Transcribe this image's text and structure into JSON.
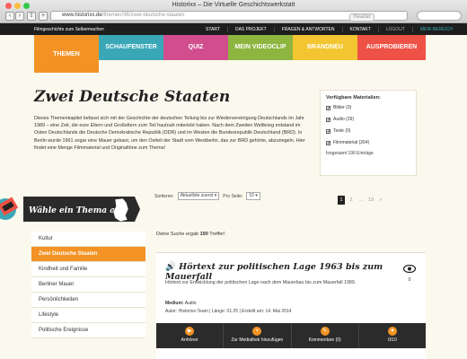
{
  "browser": {
    "window_title": "Historixx – Die Virtuelle Geschichtswerkstatt",
    "url_host": "www.historixx.de",
    "url_path": "/themen/36/zwei-deutsche-staaten",
    "reader_label": "Reader",
    "colors": {
      "close": "#fc615d",
      "minimize": "#fdbc40",
      "zoom": "#34c84a"
    }
  },
  "topbar": {
    "slogan": "Filmgeschichte zum Selbermachen",
    "nav": [
      "START",
      "DAS PROJEKT",
      "FRAGEN & ANTWORTEN",
      "KONTAKT",
      "LOGOUT",
      "MEIN BEREICH"
    ]
  },
  "tabs": [
    {
      "label": "THEMEN",
      "color": "#f39325"
    },
    {
      "label": "SCHAUFENSTER",
      "color": "#3aa7b7"
    },
    {
      "label": "QUIZ",
      "color": "#d14d8e"
    },
    {
      "label": "MEIN VIDEOCLIP",
      "color": "#8db53f"
    },
    {
      "label": "BRANDNEU",
      "color": "#f3c631"
    },
    {
      "label": "AUSPROBIEREN",
      "color": "#ee5145"
    }
  ],
  "page": {
    "title": "Zwei Deutsche Staaten",
    "intro": "Dieses Themenkapitel befasst sich mit der Geschichte der deutschen Teilung bis zur Wiedervereinigung Deutschlands im Jahr 1989 – eine Zeit, die eure Eltern und Großeltern zum Teil hautnah miterlebt haben. Nach dem Zweiten Weltkrieg entstand im Osten Deutschlands die Deutsche Demokratische Republik (DDR) und im Westen die Bundesrepublik Deutschland (BRD). In Berlin wurde 1961 sogar eine Mauer gebaut, um den Ostteil der Stadt vom Westberlin, das zur BRD gehörte, abzuriegeln. Hier findet eine Menge Filmmaterial und Originaltöne zum Thema!"
  },
  "materials": {
    "heading": "Verfügbare Materialien:",
    "items": [
      {
        "label": "Bilder (0)",
        "checked": true
      },
      {
        "label": "Audio (29)",
        "checked": true
      },
      {
        "label": "Texte (0)",
        "checked": true
      },
      {
        "label": "Filmmaterial (264)",
        "checked": true
      }
    ],
    "total": "Insgesamt 190 Einträge"
  },
  "sidebar": {
    "banner": "Wähle ein Thema aus",
    "items": [
      "Kultur",
      "Zwei Deutsche Staaten",
      "Kindheit und Familie",
      "Berliner Mauer",
      "Persönlichkeiten",
      "Lifestyle",
      "Politische Ereignisse"
    ],
    "active_index": 1
  },
  "sort": {
    "label": "Sortieren:",
    "value": "Aktuellste zuerst",
    "per_page_label": "Pro Seite:",
    "per_page_value": "10"
  },
  "pager": [
    "1",
    "2",
    "...",
    "19",
    "»"
  ],
  "results": {
    "prefix": "Deine Suche ergab",
    "count": "190",
    "suffix": "Treffer!"
  },
  "card": {
    "title": "Hörtext zur politischen Lage 1963 bis zum Mauerfall",
    "description": "Hörtext zur Entwicklung der politischen Lage nach dem Mauerbau bis zum Mauerfall 1989.",
    "medium_label": "Medium:",
    "medium_value": "Audio",
    "author_line": "Autor:  Historixx-Team  |  Länge:  01:25  |  Erstellt am:  14. Mai 2014",
    "views": "0",
    "actions": [
      "Anhören",
      "Zur Mediathek hinzufügen",
      "Kommentare (0)",
      "0/10"
    ]
  }
}
